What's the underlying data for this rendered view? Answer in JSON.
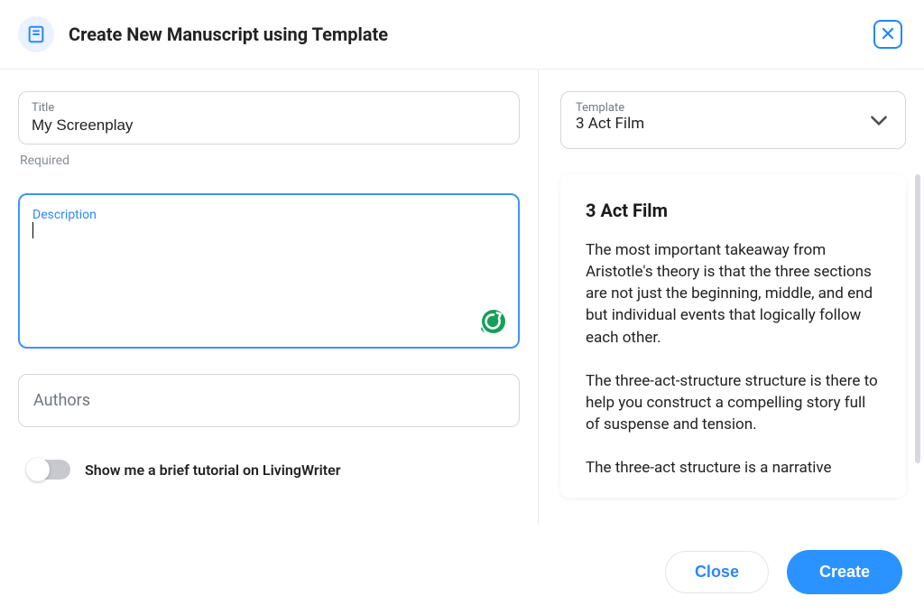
{
  "header": {
    "title": "Create New Manuscript using Template"
  },
  "form": {
    "title_label": "Title",
    "title_value": "My Screenplay",
    "title_hint": "Required",
    "desc_label": "Description",
    "desc_value": "",
    "authors_label": "Authors",
    "tutorial_toggle_label": "Show me a brief tutorial on LivingWriter"
  },
  "template": {
    "label": "Template",
    "value": "3 Act Film",
    "info_title": "3 Act Film",
    "info_paras": [
      "The most important takeaway from Aristotle's theory is that the three sections are not just the beginning, middle, and end but individual events that logically follow each other.",
      "The three-act-structure structure is there to help you construct a compelling story full of suspense and tension.",
      "The three-act structure is a narrative"
    ]
  },
  "footer": {
    "close_label": "Close",
    "create_label": "Create"
  }
}
